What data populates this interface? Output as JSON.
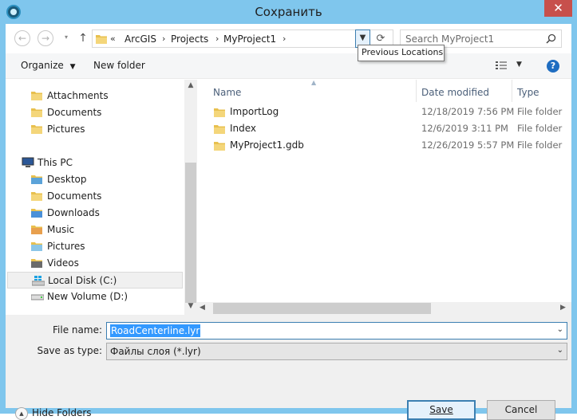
{
  "window": {
    "title": "Сохранить",
    "close_label": "✕"
  },
  "address": {
    "crumbs": [
      "ArcGIS",
      "Projects",
      "MyProject1"
    ],
    "overflow": "«",
    "separator": "›"
  },
  "search": {
    "placeholder": "Search MyProject1"
  },
  "tooltip": "Previous Locations",
  "toolbar": {
    "organize": "Organize",
    "new_folder": "New folder",
    "help": "?"
  },
  "nav": {
    "items": [
      {
        "label": "Attachments",
        "icon": "folder-icon"
      },
      {
        "label": "Documents",
        "icon": "folder-icon"
      },
      {
        "label": "Pictures",
        "icon": "folder-icon"
      },
      {
        "label": "This PC",
        "icon": "computer-icon"
      },
      {
        "label": "Desktop",
        "icon": "desktop-folder-icon"
      },
      {
        "label": "Documents",
        "icon": "documents-folder-icon"
      },
      {
        "label": "Downloads",
        "icon": "downloads-folder-icon"
      },
      {
        "label": "Music",
        "icon": "music-folder-icon"
      },
      {
        "label": "Pictures",
        "icon": "pictures-folder-icon"
      },
      {
        "label": "Videos",
        "icon": "videos-folder-icon"
      },
      {
        "label": "Local Disk (C:)",
        "icon": "windows-drive-icon"
      },
      {
        "label": "New Volume (D:)",
        "icon": "drive-icon"
      }
    ]
  },
  "files": {
    "columns": [
      "Name",
      "Date modified",
      "Type"
    ],
    "rows": [
      {
        "name": "ImportLog",
        "date": "12/18/2019 7:56 PM",
        "type": "File folder"
      },
      {
        "name": "Index",
        "date": "12/6/2019 3:11 PM",
        "type": "File folder"
      },
      {
        "name": "MyProject1.gdb",
        "date": "12/26/2019 5:57 PM",
        "type": "File folder"
      }
    ]
  },
  "form": {
    "file_name_label": "File name:",
    "file_name_value": "RoadCenterline.lyr",
    "save_type_label": "Save as type:",
    "save_type_value": "Файлы слоя (*.lyr)"
  },
  "buttons": {
    "hide_folders": "Hide Folders",
    "save": "Save",
    "cancel": "Cancel"
  },
  "colors": {
    "titlebar": "#7fc6ed",
    "close": "#c7504c",
    "folder": "#e8c04e",
    "selection": "#3399ff",
    "accent": "#3c7fb1"
  }
}
